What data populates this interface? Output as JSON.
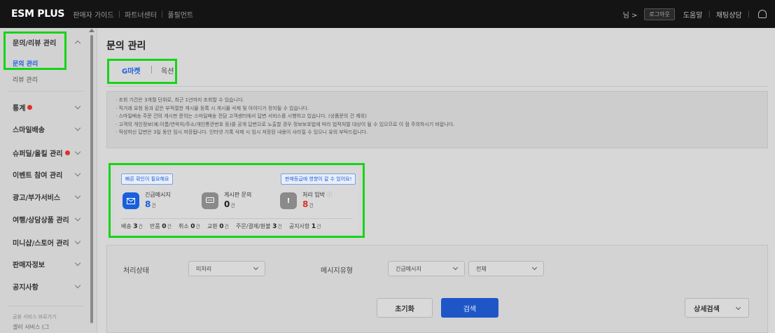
{
  "topbar": {
    "logo": "ESM PLUS",
    "nav": [
      "판매자 가이드",
      "파트너센터",
      "풀필먼트"
    ],
    "user": "님 >",
    "logout": "로그아웃",
    "help": "도움말",
    "chat": "채팅상담",
    "bell_icon": "bell-icon"
  },
  "sidebar": {
    "group_review": "문의/리뷰 관리",
    "sub_inquiry": "문의 관리",
    "sub_review": "리뷰 관리",
    "items": [
      {
        "label": "통계",
        "dot": true
      },
      {
        "label": "스마일배송",
        "dot": false
      },
      {
        "label": "슈퍼딜/올킬 관리",
        "dot": true
      },
      {
        "label": "이벤트 참여 관리",
        "dot": false
      },
      {
        "label": "광고/부가서비스",
        "dot": false
      },
      {
        "label": "여행/상담상품 관리",
        "dot": false
      },
      {
        "label": "미니샵/스토어 관리",
        "dot": false
      },
      {
        "label": "판매자정보",
        "dot": false
      },
      {
        "label": "공지사항",
        "dot": false
      }
    ],
    "footer1": "금융 서비스 바로가기",
    "footer2": "셀러 서비스 (그"
  },
  "main": {
    "title": "문의 관리",
    "tabs": [
      {
        "label": "G마켓",
        "active": true
      },
      {
        "label": "옥션",
        "active": false
      }
    ],
    "notices": [
      "· 조회 기간은 3개월 단위로, 최근 1년까지 조회할 수 있습니다.",
      "· 직거래 요청 등과 같은 부적절한 게시물 등록 시 게시물 삭제 및 아이디가 정지될 수 있습니다.",
      "· 스마일배송 주문 건의 게시판 문의는 스마일배송 전담 고객센터에서 답변 서비스를 시행하고 있습니다. (상품문의 건 제외)",
      "· 고객의 개인정보(예:이름/연락처/주소/개인통관번호 등)를 공개 답변으로 노출할 경우 정보보호법에 따라 법적처벌 대상이 될 수 있으므로 이 점 주의하시기 바랍니다.",
      "· 작성하신 답변은 3일 동안 임시 저장됩니다. 인터넷 기록 삭제 시 임시 저장된 내용이 사라질 수 있으니 유의 부탁드립니다."
    ]
  },
  "summary": {
    "pill_left": "빠른 확인이 필요해요",
    "pill_right": "판매등급에 영향이 갈 수 있어요!",
    "stats": [
      {
        "label": "긴급메시지",
        "value": "8",
        "unit": "건",
        "icon": "mail-icon",
        "color": "#1a5fdc"
      },
      {
        "label": "게시판 문의",
        "value": "0",
        "unit": "건",
        "icon": "chat-icon",
        "color": "#222222"
      },
      {
        "label": "처리 임박",
        "value": "8",
        "unit": "건",
        "icon": "alert-icon",
        "color": "#e0302a"
      }
    ],
    "info_icon": "info-icon",
    "counts": [
      {
        "label": "배송",
        "value": "3",
        "unit": "건"
      },
      {
        "label": "반품",
        "value": "0",
        "unit": "건"
      },
      {
        "label": "취소",
        "value": "0",
        "unit": "건"
      },
      {
        "label": "교환",
        "value": "0",
        "unit": "건"
      },
      {
        "label": "주문/결제/환불",
        "value": "3",
        "unit": "건"
      },
      {
        "label": "공지사항",
        "value": "1",
        "unit": "건"
      }
    ]
  },
  "filters": {
    "status_label": "처리상태",
    "status_value": "미처리",
    "type_label": "메시지유형",
    "type_value": "긴급메시지",
    "type_sub_value": "전체",
    "reset": "초기화",
    "search": "검색",
    "detail": "상세검색"
  }
}
